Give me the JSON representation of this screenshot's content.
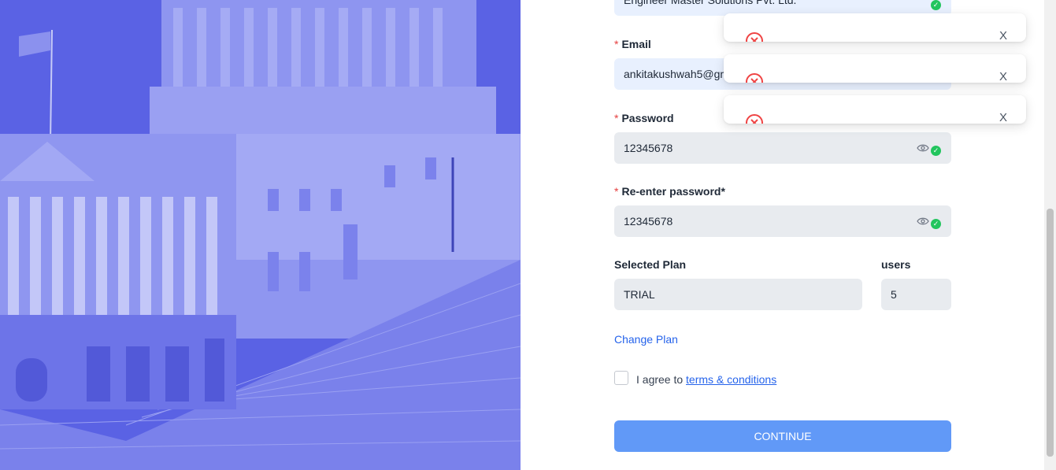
{
  "form": {
    "company_value": "Engineer Master Solutions Pvt. Ltd.",
    "email_label": "Email",
    "email_value": "ankitakushwah5@gm",
    "password_label": "Password",
    "password_value": "12345678",
    "reenter_label": "Re-enter password*",
    "reenter_value": "12345678",
    "plan_label": "Selected Plan",
    "plan_value": "TRIAL",
    "users_label": "users",
    "users_value": "5",
    "change_plan": "Change Plan",
    "agree_text": "I agree to",
    "terms_link": "terms & conditions",
    "continue": "CONTINUE",
    "required_mark": "*"
  },
  "toasts": [
    {
      "icon": "error-icon",
      "close": "X"
    },
    {
      "icon": "error-icon",
      "close": "X"
    },
    {
      "icon": "error-icon",
      "close": "X"
    }
  ],
  "colors": {
    "hero": "#5b63e6",
    "primary_button": "#6199f7",
    "link": "#2563eb",
    "success": "#22c55e",
    "error": "#ef4444"
  }
}
